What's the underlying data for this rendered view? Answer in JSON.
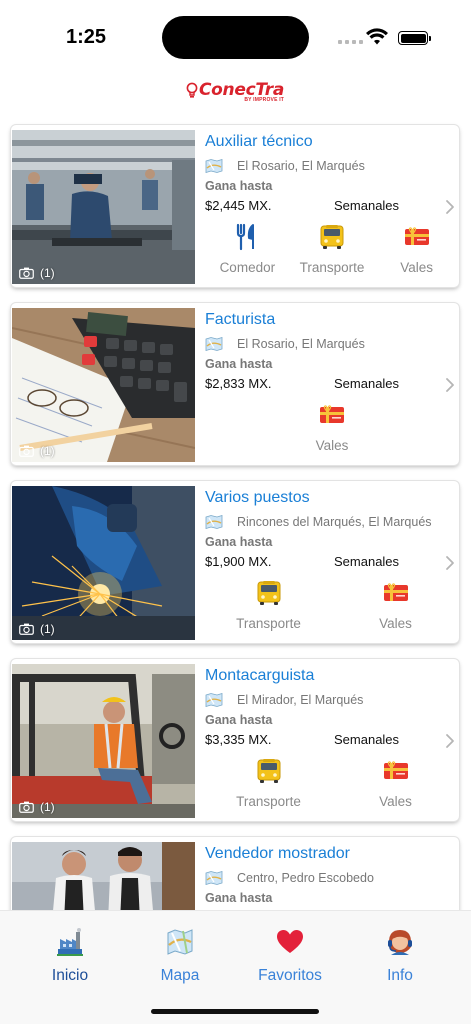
{
  "status_bar": {
    "time": "1:25"
  },
  "brand": {
    "name": "ConecTra",
    "sub": "BY IMPROVE IT"
  },
  "jobs": [
    {
      "title": "Auxiliar técnico",
      "location": "El Rosario, El Marqués",
      "earn_label": "Gana hasta",
      "salary": "$2,445 MX.",
      "period": "Semanales",
      "photo_count": "(1)",
      "benefits": [
        {
          "label": "Comedor",
          "icon": "utensils-icon"
        },
        {
          "label": "Transporte",
          "icon": "bus-icon"
        },
        {
          "label": "Vales",
          "icon": "voucher-icon"
        }
      ]
    },
    {
      "title": "Facturista",
      "location": "El Rosario, El Marqués",
      "earn_label": "Gana hasta",
      "salary": "$2,833 MX.",
      "period": "Semanales",
      "photo_count": "(1)",
      "benefits": [
        {
          "label": "Vales",
          "icon": "voucher-icon"
        }
      ]
    },
    {
      "title": "Varios puestos",
      "location": "Rincones del Marqués, El Marqués",
      "earn_label": "Gana hasta",
      "salary": "$1,900 MX.",
      "period": "Semanales",
      "photo_count": "(1)",
      "benefits": [
        {
          "label": "Transporte",
          "icon": "bus-icon"
        },
        {
          "label": "Vales",
          "icon": "voucher-icon"
        }
      ]
    },
    {
      "title": "Montacarguista",
      "location": "El Mirador, El Marqués",
      "earn_label": "Gana hasta",
      "salary": "$3,335 MX.",
      "period": "Semanales",
      "photo_count": "(1)",
      "benefits": [
        {
          "label": "Transporte",
          "icon": "bus-icon"
        },
        {
          "label": "Vales",
          "icon": "voucher-icon"
        }
      ]
    },
    {
      "title": "Vendedor mostrador",
      "location": "Centro, Pedro Escobedo",
      "earn_label": "Gana hasta"
    }
  ],
  "tabs": [
    {
      "label": "Inicio",
      "icon": "factory-icon",
      "active": true
    },
    {
      "label": "Mapa",
      "icon": "map-icon"
    },
    {
      "label": "Favoritos",
      "icon": "heart-icon"
    },
    {
      "label": "Info",
      "icon": "support-agent-icon"
    }
  ],
  "colors": {
    "accent": "#1a7fd6",
    "brand_red": "#d9232d",
    "tab_active": "#1d4e98",
    "tab_inactive": "#3a82d8"
  }
}
